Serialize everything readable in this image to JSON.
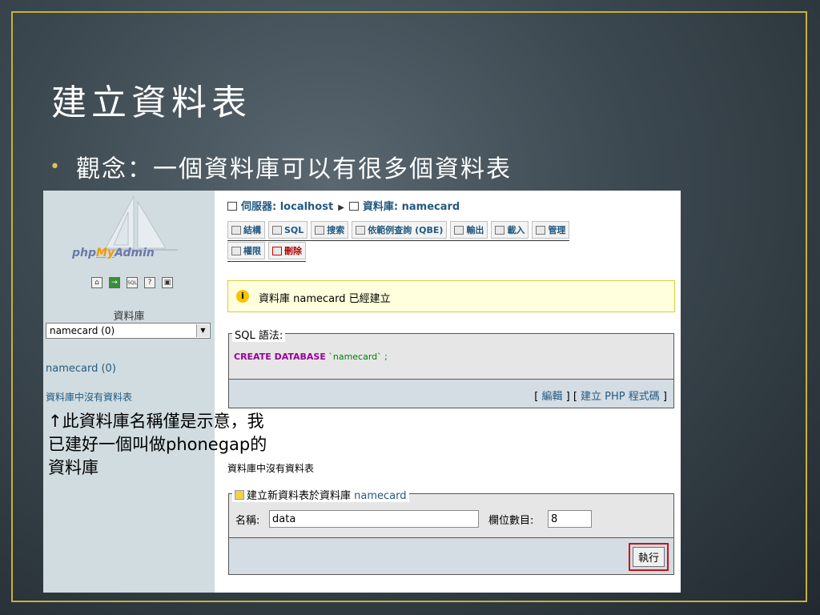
{
  "slide": {
    "title": "建立資料表",
    "bullet": "觀念：一個資料庫可以有很多個資料表"
  },
  "sidebar": {
    "logo": {
      "php": "php",
      "my": "My",
      "admin": "Admin"
    },
    "icons": [
      "home-icon",
      "exit-icon",
      "sql-icon",
      "help-icon",
      "query-window-icon"
    ],
    "db_label": "資料庫",
    "db_select_value": "namecard (0)",
    "db_link": "namecard (0)",
    "no_tables": "資料庫中沒有資料表"
  },
  "note": {
    "line1": "↑此資料庫名稱僅是示意，我",
    "line2": "已建好一個叫做phonegap的",
    "line3": "資料庫"
  },
  "breadcrumb": {
    "server": "伺服器: localhost",
    "database": "資料庫: namecard"
  },
  "tabs": {
    "row1": [
      "結構",
      "SQL",
      "搜索",
      "依範例查詢 (QBE)",
      "輸出",
      "載入",
      "管理"
    ],
    "row2": [
      "權限",
      "刪除"
    ]
  },
  "notice": "資料庫 namecard 已經建立",
  "sql_box": {
    "legend": "SQL 語法:",
    "keyword": "CREATE DATABASE",
    "string": "`namecard`",
    "tail": " ;",
    "edit": "編輯",
    "create_php": "建立 PHP 程式碼"
  },
  "main_no_tables": "資料庫中沒有資料表",
  "new_table": {
    "legend_prefix": "建立新資料表於資料庫",
    "legend_db": "namecard",
    "name_label": "名稱:",
    "name_value": "data",
    "cols_label": "欄位數目:",
    "cols_value": "8",
    "go_label": "執行"
  },
  "colors": {
    "accent_border": "#c9b13a",
    "link": "#235a81",
    "highlight": "#d01010"
  }
}
